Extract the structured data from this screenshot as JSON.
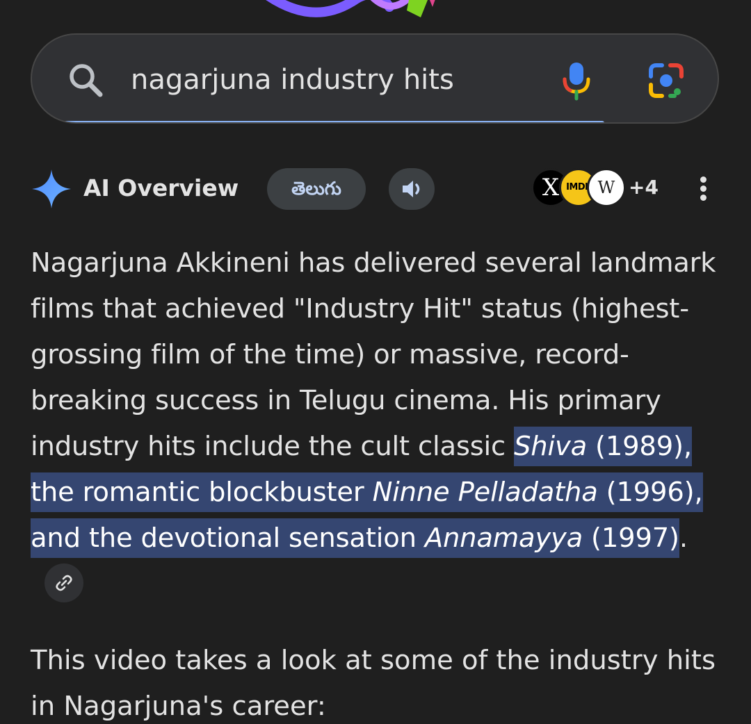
{
  "search": {
    "query": "nagarjuna industry hits",
    "progress_fraction": 0.86
  },
  "ai_overview": {
    "title": "AI Overview",
    "language_chip": "తెలుగు",
    "sources": {
      "x_label": "X",
      "imdb_label": "IMDb",
      "wiki_label": "W",
      "more_count": "+4"
    }
  },
  "answer": {
    "p1_a": "Nagarjuna Akkineni has delivered several landmark films that achieved \"Industry Hit\" status (highest-grossing film of the time) or massive, record-breaking success in Telugu cinema. His primary industry hits include the cult classic ",
    "p1_hl_1": "Shiva",
    "p1_hl_2": " (1989), the romantic blockbuster ",
    "p1_hl_3": "Ninne Pelladatha",
    "p1_hl_4": " (1996), and the devotional sensation ",
    "p1_hl_5": "Annamayya",
    "p1_hl_6": " (1997)",
    "p1_end": ".",
    "p2": "This video takes a look at some of the industry hits in Nagarjuna's career:"
  },
  "colors": {
    "background": "#1f1f1f",
    "highlight": "#354671",
    "progress": "#8ab4f8"
  }
}
